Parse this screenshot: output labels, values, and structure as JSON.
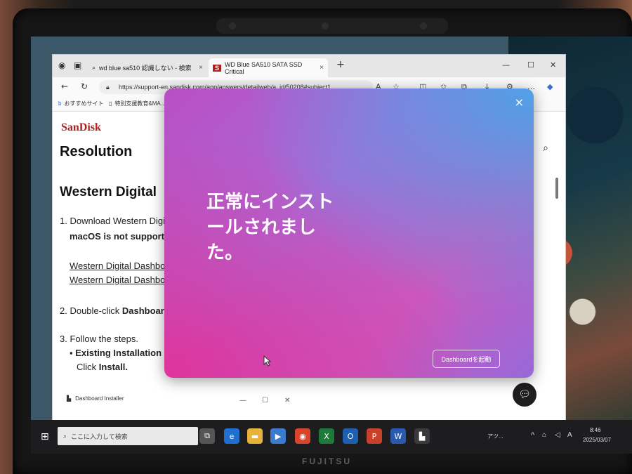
{
  "browser": {
    "tabs": [
      {
        "label": "wd blue sa510 認識しない - 検索",
        "active": false
      },
      {
        "label": "WD Blue SA510 SATA SSD Critical",
        "active": true
      }
    ],
    "new_tab": "+",
    "url": "https://support-en.sandisk.com/app/answers/detailweb/a_id/50208#subject1",
    "favorites": [
      {
        "label": "おすすめサイト"
      },
      {
        "label": "特別支援教育&MA..."
      }
    ]
  },
  "page": {
    "logo": "SanDisk",
    "heading": "Resolution",
    "subheading": "Western Digital",
    "step1_text": "1. Download Western Digit",
    "step1_note": "macOS is not supportec",
    "link1": "Western Digital Dashboa",
    "link2": "Western Digital Dashboa",
    "step2_text": "2. Double-click",
    "step2_bold": "Dashboard",
    "step3_text": "3. Follow the steps.",
    "step3_item": "Existing Installation",
    "step3_click": "Click",
    "step3_install": "Install."
  },
  "installer_bar": {
    "label": "Dashboard Installer"
  },
  "dialog": {
    "title": "正常にインストールされました。",
    "button": "Dashboardを起動",
    "close": "×",
    "accent_pink": "#e0339a",
    "accent_blue": "#4fa1e6"
  },
  "taskbar": {
    "search_placeholder": "ここに入力して検索",
    "tray_text": "アツ...",
    "time": "8:46",
    "date": "2025/03/07"
  },
  "laptop": {
    "brand": "FUJITSU"
  }
}
